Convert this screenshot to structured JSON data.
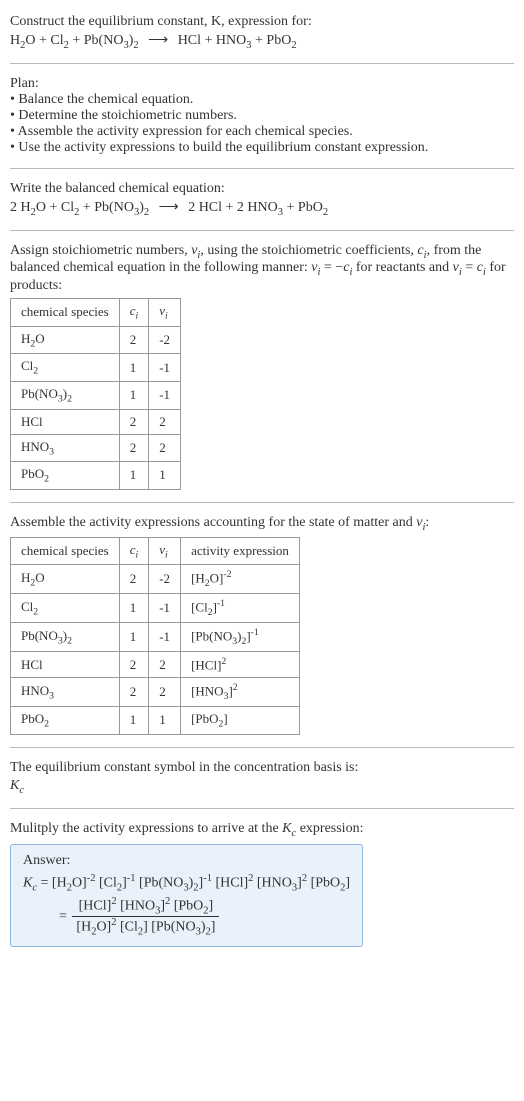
{
  "intro": {
    "line": "Construct the equilibrium constant, K, expression for:"
  },
  "plan": {
    "heading": "Plan:",
    "b1": "• Balance the chemical equation.",
    "b2": "• Determine the stoichiometric numbers.",
    "b3": "• Assemble the activity expression for each chemical species.",
    "b4": "• Use the activity expressions to build the equilibrium constant expression."
  },
  "balanced": {
    "line": "Write the balanced chemical equation:"
  },
  "assign": {
    "part1": "Assign stoichiometric numbers, ",
    "part2": ", using the stoichiometric coefficients, ",
    "part3": ", from the balanced chemical equation in the following manner: ",
    "part4": " for reactants and ",
    "part5": " for products:"
  },
  "table1": {
    "h1": "chemical species",
    "h2": "cᵢ",
    "h3": "νᵢ",
    "rows": [
      {
        "sp": "H2O",
        "c": "2",
        "v": "-2"
      },
      {
        "sp": "Cl2",
        "c": "1",
        "v": "-1"
      },
      {
        "sp": "Pb(NO3)2",
        "c": "1",
        "v": "-1"
      },
      {
        "sp": "HCl",
        "c": "2",
        "v": "2"
      },
      {
        "sp": "HNO3",
        "c": "2",
        "v": "2"
      },
      {
        "sp": "PbO2",
        "c": "1",
        "v": "1"
      }
    ]
  },
  "assemble": {
    "part1": "Assemble the activity expressions accounting for the state of matter and ",
    "part2": ":"
  },
  "table2": {
    "h1": "chemical species",
    "h2": "cᵢ",
    "h3": "νᵢ",
    "h4": "activity expression",
    "rows": [
      {
        "sp": "H2O",
        "c": "2",
        "v": "-2",
        "a": "[H2O]^-2"
      },
      {
        "sp": "Cl2",
        "c": "1",
        "v": "-1",
        "a": "[Cl2]^-1"
      },
      {
        "sp": "Pb(NO3)2",
        "c": "1",
        "v": "-1",
        "a": "[Pb(NO3)2]^-1"
      },
      {
        "sp": "HCl",
        "c": "2",
        "v": "2",
        "a": "[HCl]^2"
      },
      {
        "sp": "HNO3",
        "c": "2",
        "v": "2",
        "a": "[HNO3]^2"
      },
      {
        "sp": "PbO2",
        "c": "1",
        "v": "1",
        "a": "[PbO2]"
      }
    ]
  },
  "symbol": {
    "line": "The equilibrium constant symbol in the concentration basis is:"
  },
  "multiply": {
    "part1": "Mulitply the activity expressions to arrive at the ",
    "part2": " expression:"
  },
  "answer": {
    "label": "Answer:"
  }
}
